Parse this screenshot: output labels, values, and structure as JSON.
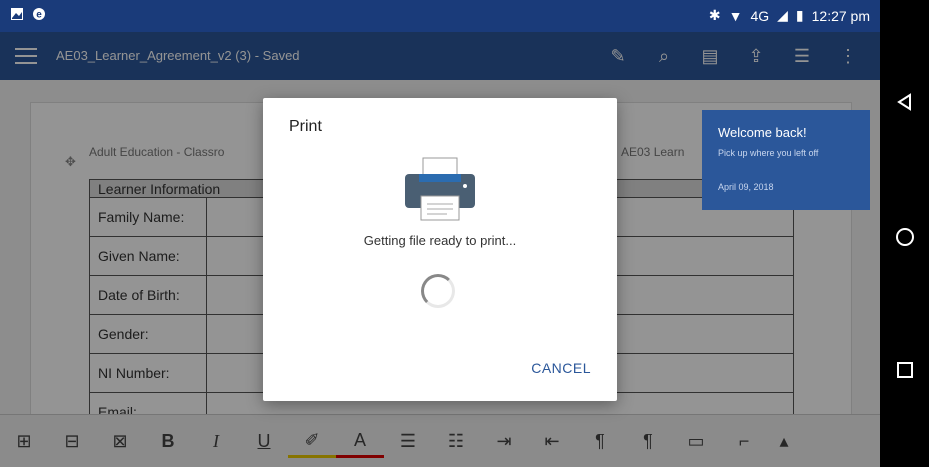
{
  "status_bar": {
    "time": "12:27 pm",
    "network": "4G",
    "icons": [
      "image-icon",
      "browser-icon",
      "bluetooth-icon",
      "wifi-icon",
      "signal-icon",
      "battery-icon"
    ]
  },
  "app_bar": {
    "document_title": "AE03_Learner_Agreement_v2 (3) - Saved",
    "icons": [
      "pen-icon",
      "search-icon",
      "document-icon",
      "share-icon",
      "read-mode-icon",
      "more-icon"
    ]
  },
  "document": {
    "heading": "Adult Education - Classro",
    "heading_right": "AE03 Learn",
    "table": {
      "header": "Learner Information",
      "rows": [
        "Family Name:",
        "Given Name:",
        "Date of Birth:",
        "Gender:",
        "NI Number:",
        "Email:"
      ]
    }
  },
  "welcome_card": {
    "title": "Welcome back!",
    "subtitle": "Pick up where you left off",
    "date": "April 09, 2018"
  },
  "print_dialog": {
    "title": "Print",
    "message": "Getting file ready to print...",
    "cancel_label": "CANCEL"
  },
  "toolbar": {
    "bold_label": "B",
    "italic_label": "I",
    "underline_label": "U",
    "font_color_label": "A",
    "icons": [
      "insert-table-icon",
      "insert-row-icon",
      "delete-table-icon",
      "bold-icon",
      "italic-icon",
      "underline-icon",
      "highlight-icon",
      "font-color-icon",
      "bullets-icon",
      "numbering-icon",
      "indent-increase-icon",
      "indent-decrease-icon",
      "ltr-paragraph-icon",
      "rtl-paragraph-icon",
      "comment-icon",
      "format-painter-icon",
      "expand-icon"
    ]
  },
  "colors": {
    "accent": "#2b579a",
    "status_bar": "#1a3b7a"
  }
}
